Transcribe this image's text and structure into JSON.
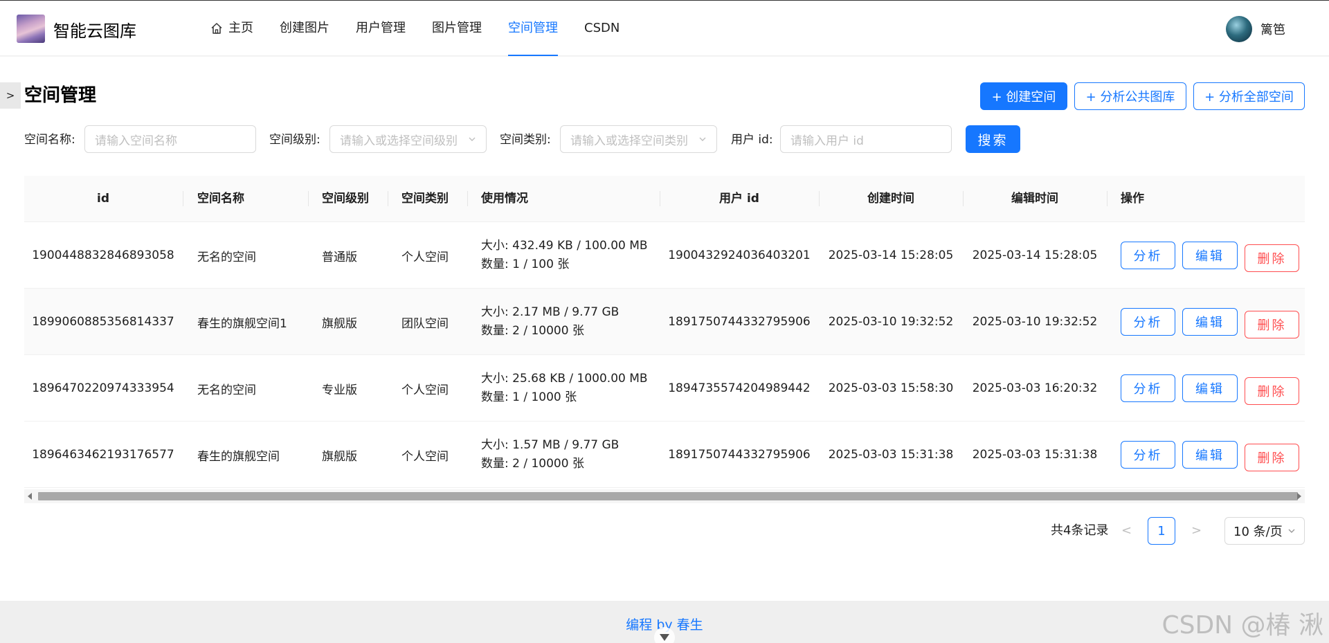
{
  "header": {
    "brand": "智能云图库",
    "nav": [
      {
        "label": "主页",
        "icon": "home-icon",
        "active": false
      },
      {
        "label": "创建图片",
        "active": false
      },
      {
        "label": "用户管理",
        "active": false
      },
      {
        "label": "图片管理",
        "active": false
      },
      {
        "label": "空间管理",
        "active": true
      },
      {
        "label": "CSDN",
        "active": false
      }
    ],
    "user_name": "篱笆"
  },
  "sidebar_toggle": ">",
  "page": {
    "title": "空间管理",
    "actions": {
      "create": "+ 创建空间",
      "analyze_public": "+ 分析公共图库",
      "analyze_all": "+ 分析全部空间"
    }
  },
  "filters": {
    "space_name_label": "空间名称:",
    "space_name_placeholder": "请输入空间名称",
    "space_level_label": "空间级别:",
    "space_level_placeholder": "请输入或选择空间级别",
    "space_type_label": "空间类别:",
    "space_type_placeholder": "请输入或选择空间类别",
    "user_id_label": "用户 id:",
    "user_id_placeholder": "请输入用户 id",
    "search": "搜索"
  },
  "table": {
    "columns": [
      "id",
      "空间名称",
      "空间级别",
      "空间类别",
      "使用情况",
      "用户 id",
      "创建时间",
      "编辑时间",
      "操作"
    ],
    "rows": [
      {
        "id": "1900448832846893058",
        "name": "无名的空间",
        "level": "普通版",
        "type": "个人空间",
        "size": "大小: 432.49 KB / 100.00 MB",
        "count": "数量: 1 / 100 张",
        "user_id": "1900432924036403201",
        "created": "2025-03-14 15:28:05",
        "edited": "2025-03-14 15:28:05"
      },
      {
        "id": "1899060885356814337",
        "name": "春生的旗舰空间1",
        "level": "旗舰版",
        "type": "团队空间",
        "size": "大小: 2.17 MB / 9.77 GB",
        "count": "数量: 2 / 10000 张",
        "user_id": "1891750744332795906",
        "created": "2025-03-10 19:32:52",
        "edited": "2025-03-10 19:32:52"
      },
      {
        "id": "1896470220974333954",
        "name": "无名的空间",
        "level": "专业版",
        "type": "个人空间",
        "size": "大小: 25.68 KB / 1000.00 MB",
        "count": "数量: 1 / 1000 张",
        "user_id": "1894735574204989442",
        "created": "2025-03-03 15:58:30",
        "edited": "2025-03-03 16:20:32"
      },
      {
        "id": "1896463462193176577",
        "name": "春生的旗舰空间",
        "level": "旗舰版",
        "type": "个人空间",
        "size": "大小: 1.57 MB / 9.77 GB",
        "count": "数量: 2 / 10000 张",
        "user_id": "1891750744332795906",
        "created": "2025-03-03 15:31:38",
        "edited": "2025-03-03 15:31:38"
      }
    ],
    "row_actions": {
      "analyze": "分析",
      "edit": "编辑",
      "delete": "删除"
    }
  },
  "pagination": {
    "total": "共4条记录",
    "prev": "<",
    "current": "1",
    "next": ">",
    "page_size": "10 条/页"
  },
  "footer": {
    "text": "编程 by 春生"
  },
  "watermark": "CSDN @椿  湫",
  "colors": {
    "primary": "#1677ff",
    "danger": "#ff4d4f"
  }
}
